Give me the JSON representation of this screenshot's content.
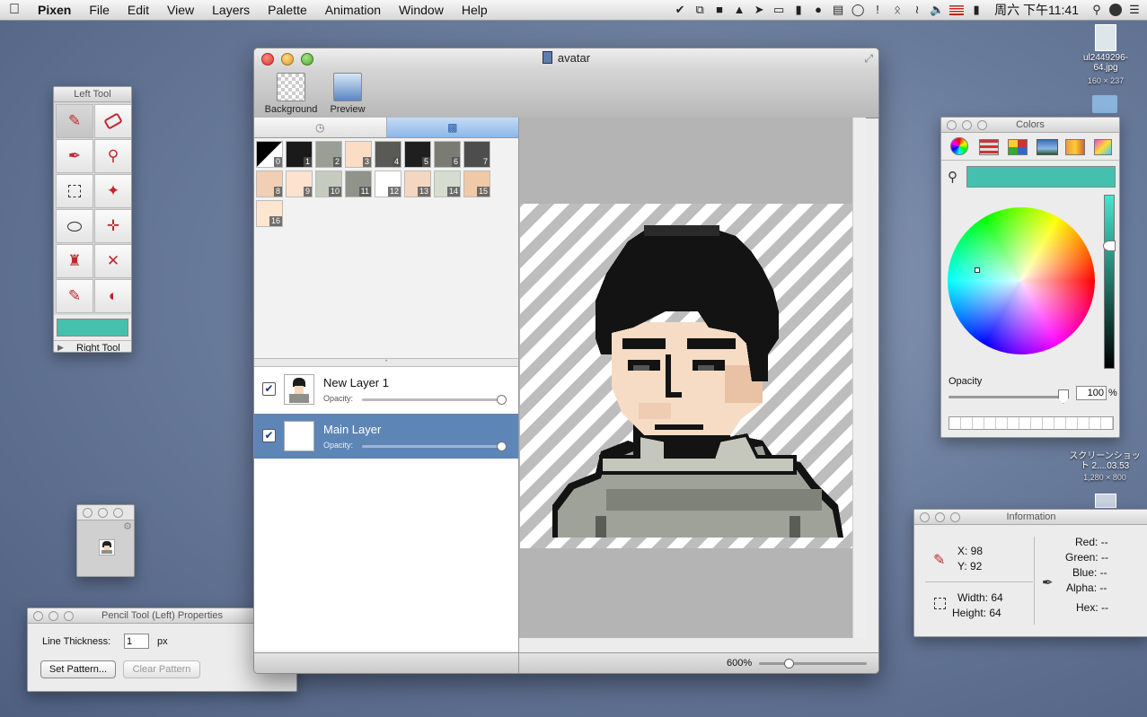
{
  "menubar": {
    "app": "Pixen",
    "items": [
      "File",
      "Edit",
      "View",
      "Layers",
      "Palette",
      "Animation",
      "Window",
      "Help"
    ],
    "clock": "周六 下午11:41"
  },
  "main_window": {
    "title": "avatar",
    "toolbar": {
      "background_label": "Background",
      "preview_label": "Preview"
    },
    "zoom": "600%",
    "swatch_numbers": [
      "0",
      "1",
      "2",
      "3",
      "4",
      "5",
      "6",
      "7",
      "8",
      "9",
      "10",
      "11",
      "12",
      "13",
      "14",
      "15",
      "16"
    ],
    "swatch_colors": [
      "#000000",
      "#1a1a1a",
      "#9a9e94",
      "#fbdcc4",
      "#595a55",
      "#1f1f1f",
      "#7a7c74",
      "#4d4d4d",
      "#f0cfb5",
      "#fde3cf",
      "#c5cbbe",
      "#8f938a",
      "#ffffff",
      "#f4d7c0",
      "#d7dcd0",
      "#f0c9a8",
      "#fde6d0"
    ],
    "layers": [
      {
        "name": "New Layer 1",
        "opacity_label": "Opacity:",
        "checked": true,
        "opacity": 1.0
      },
      {
        "name": "Main Layer",
        "opacity_label": "Opacity:",
        "checked": true,
        "opacity": 1.0
      }
    ]
  },
  "left_tool": {
    "title": "Left Tool",
    "right_tool_label": "Right Tool",
    "color": "#45c0ae",
    "tools": [
      "pencil-icon",
      "eraser-icon",
      "eyedropper-icon",
      "zoom-icon",
      "selection-icon",
      "magic-wand-icon",
      "lasso-icon",
      "move-icon",
      "fill-icon",
      "line-icon",
      "rectangle-icon",
      "ellipse-icon"
    ]
  },
  "pencil_props": {
    "title": "Pencil Tool (Left) Properties",
    "thickness_label": "Line Thickness:",
    "thickness_value": "1",
    "unit": "px",
    "set_pattern": "Set Pattern...",
    "clear_pattern": "Clear Pattern"
  },
  "colors_panel": {
    "title": "Colors",
    "current_color": "#45c0ae",
    "opacity_label": "Opacity",
    "opacity_value": "100",
    "percent": "%"
  },
  "info_panel": {
    "title": "Information",
    "x": "X: 98",
    "y": "Y: 92",
    "width": "Width: 64",
    "height": "Height: 64",
    "red": "Red: --",
    "green": "Green: --",
    "blue": "Blue: --",
    "alpha": "Alpha: --",
    "hex": "Hex: --"
  },
  "desktop": {
    "file1_name": "ul2449296-64.jpg",
    "file1_dims": "160 × 237",
    "screenshot_name": "スクリーンショット 2....03.53",
    "screenshot_dims": "1,280 × 800"
  }
}
